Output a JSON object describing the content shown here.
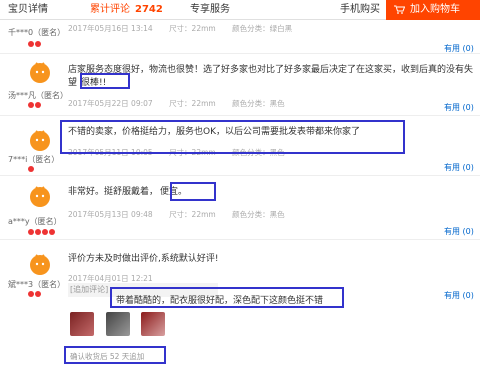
{
  "tabs": [
    {
      "label": "宝贝详情"
    },
    {
      "label": "累计评论",
      "count": "2742"
    },
    {
      "label": "专享服务"
    }
  ],
  "mobile_buy": "手机购买",
  "cart_button": "加入购物车",
  "colors": {
    "accent": "#ff4400",
    "highlight": "#3333cc",
    "useful": "#0066cc"
  },
  "reviews": [
    {
      "user": "千***0（匿名）",
      "date": "2017年05月16日 13:14",
      "size": "尺寸：22mm",
      "color": "颜色分类：绿白黑",
      "useful": "有用 (0)"
    },
    {
      "user": "汤***凡（匿名）",
      "content_a": "店家服务态度很好，物流也很赞！选了好多家也对比了好多家最后决定了在这家买，收到后真的没有失",
      "content_b_pre": "望",
      "content_b_hl": "很棒!!",
      "date": "2017年05月22日 09:07",
      "size": "尺寸：22mm",
      "color": "颜色分类：黑色",
      "useful": "有用 (0)"
    },
    {
      "user": "7***i（匿名）",
      "content": "不错的卖家，价格挺给力，服务也OK，以后公司需要批发表带都来你家了",
      "date": "2017年05月11日 10:05",
      "size": "尺寸：22mm",
      "color": "颜色分类：黑色",
      "useful": "有用 (0)"
    },
    {
      "user": "a***y（匿名）",
      "content_pre": "非常好。挺舒服戴着，",
      "content_hl": "便宜。",
      "date": "2017年05月13日 09:48",
      "size": "尺寸：22mm",
      "color": "颜色分类：黑色",
      "useful": "有用 (0)"
    },
    {
      "user": "斌***3（匿名）",
      "content": "评价方未及时做出评价,系统默认好评!",
      "date": "2017年04月01日 12:21",
      "append_label": "[追加评论]",
      "append_text": "带着酷酷的，配衣服很好配，深色配下这颜色挺不错",
      "append_note": "确认收货后 52 天追加",
      "useful": "有用 (0)"
    }
  ]
}
